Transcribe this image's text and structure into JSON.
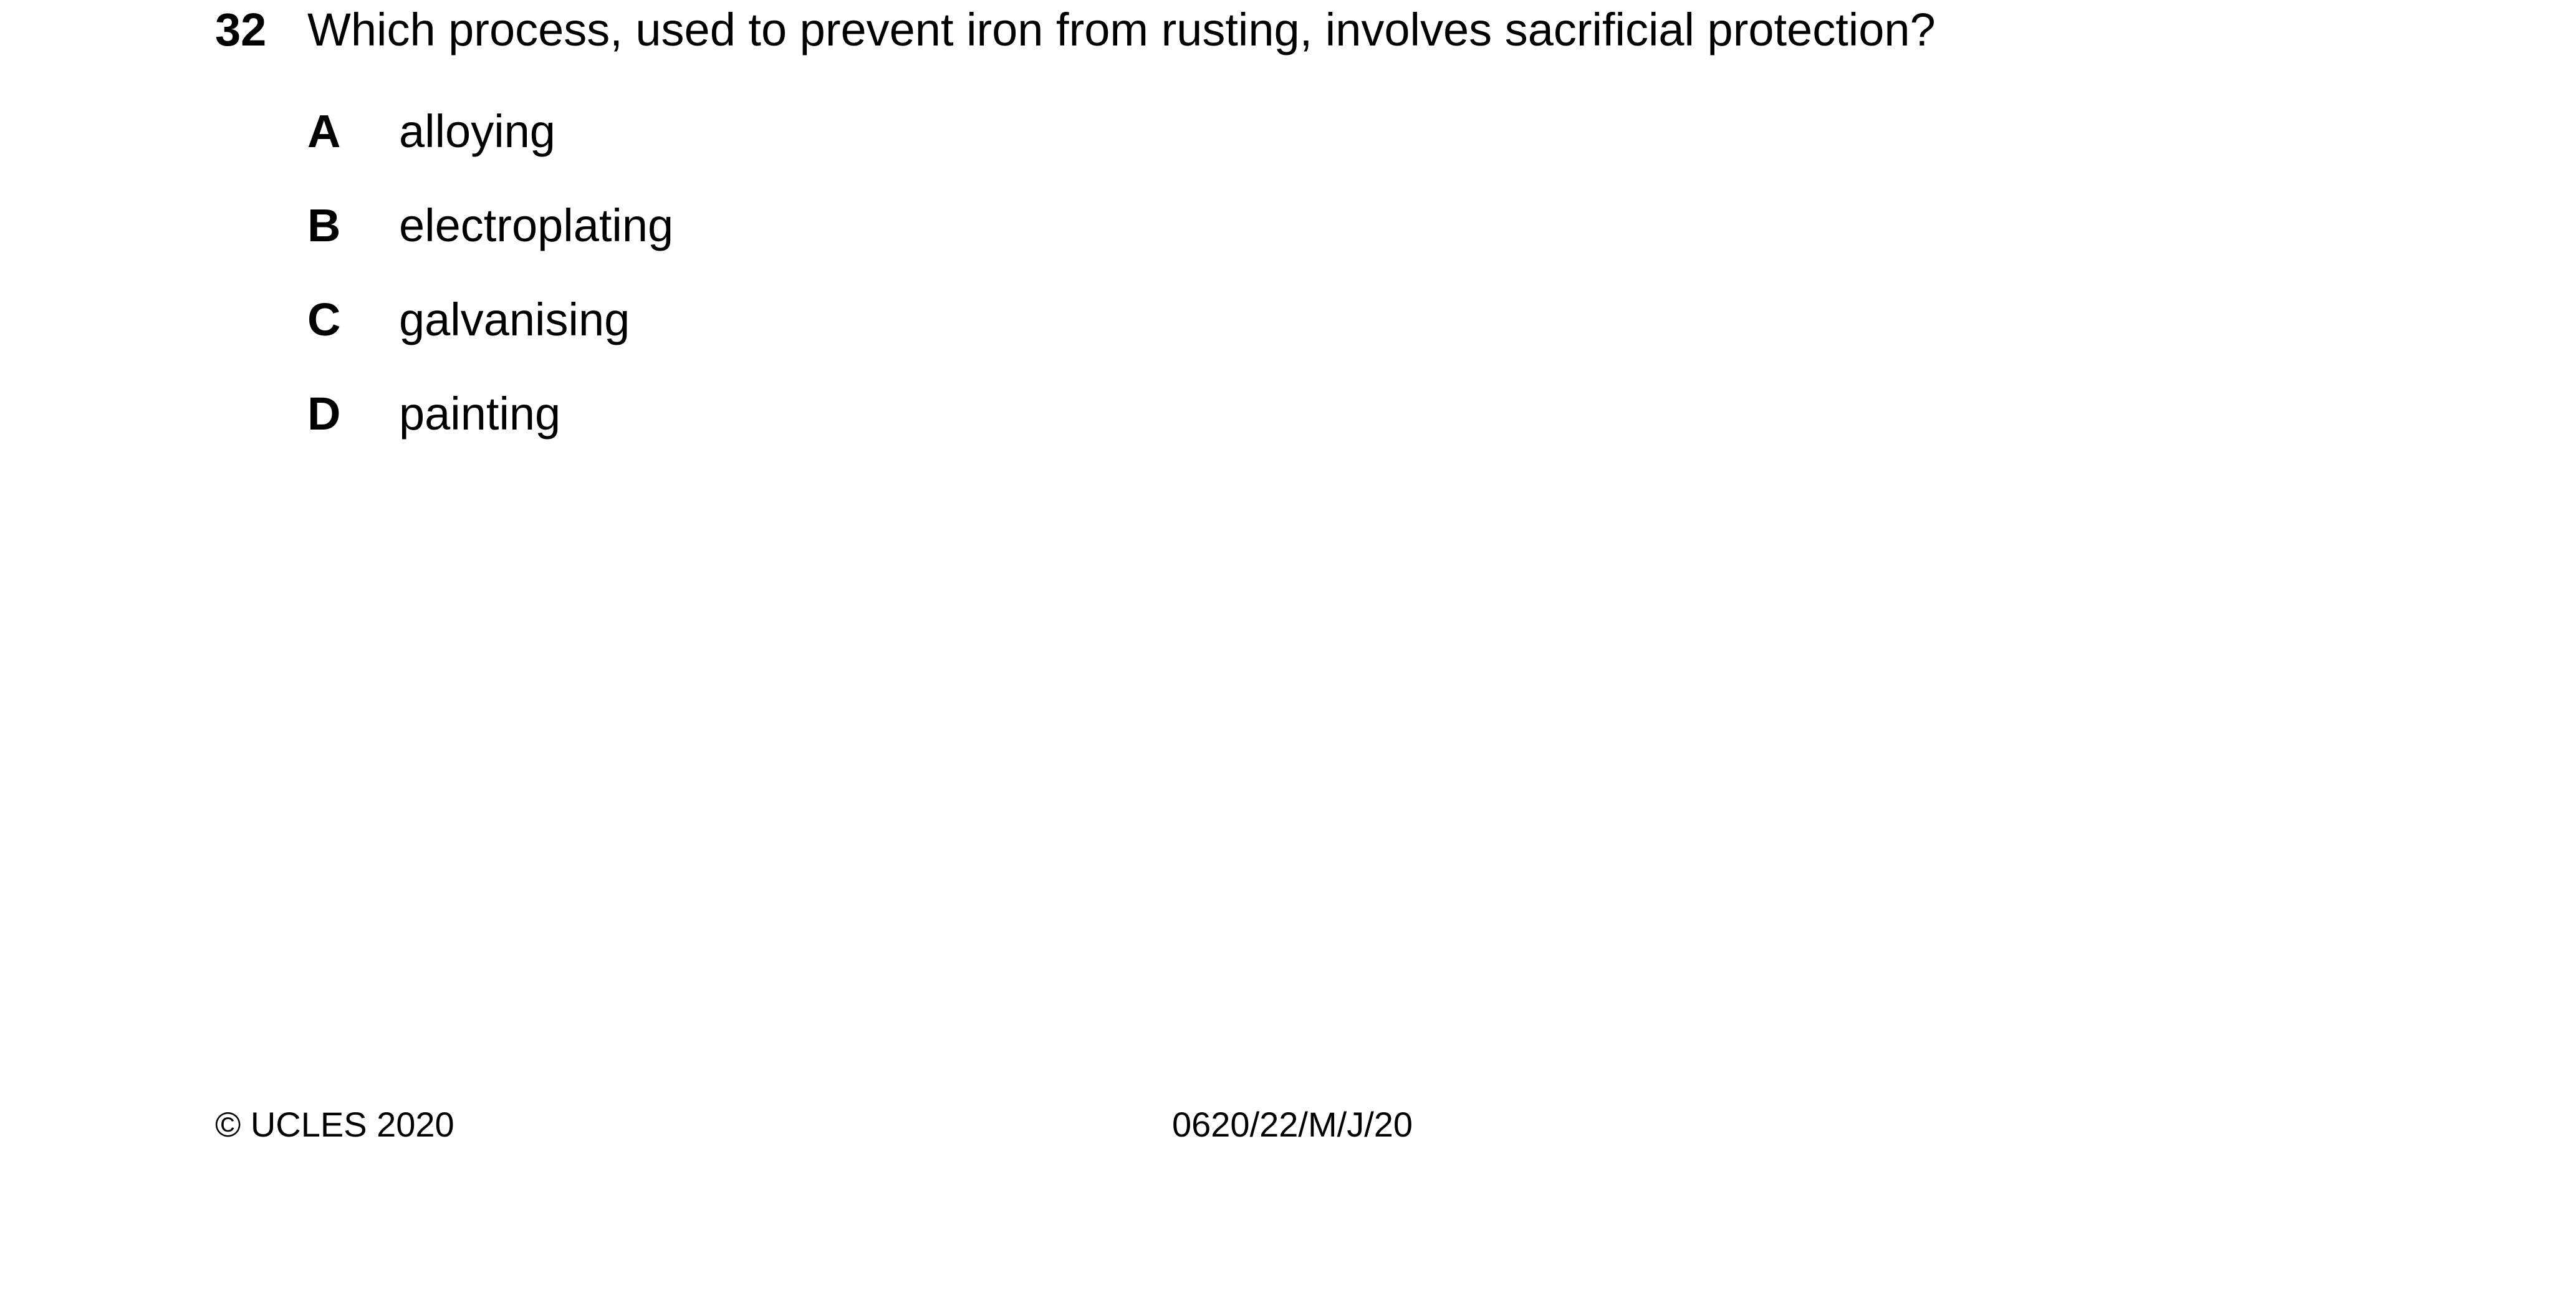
{
  "question": {
    "number": "32",
    "stem": "Which process, used to prevent iron from rusting, involves sacrificial protection?",
    "options": [
      {
        "letter": "A",
        "text": "alloying"
      },
      {
        "letter": "B",
        "text": "electroplating"
      },
      {
        "letter": "C",
        "text": "galvanising"
      },
      {
        "letter": "D",
        "text": "painting"
      }
    ]
  },
  "footer": {
    "copyright": "© UCLES 2020",
    "paper_code": "0620/22/M/J/20"
  }
}
